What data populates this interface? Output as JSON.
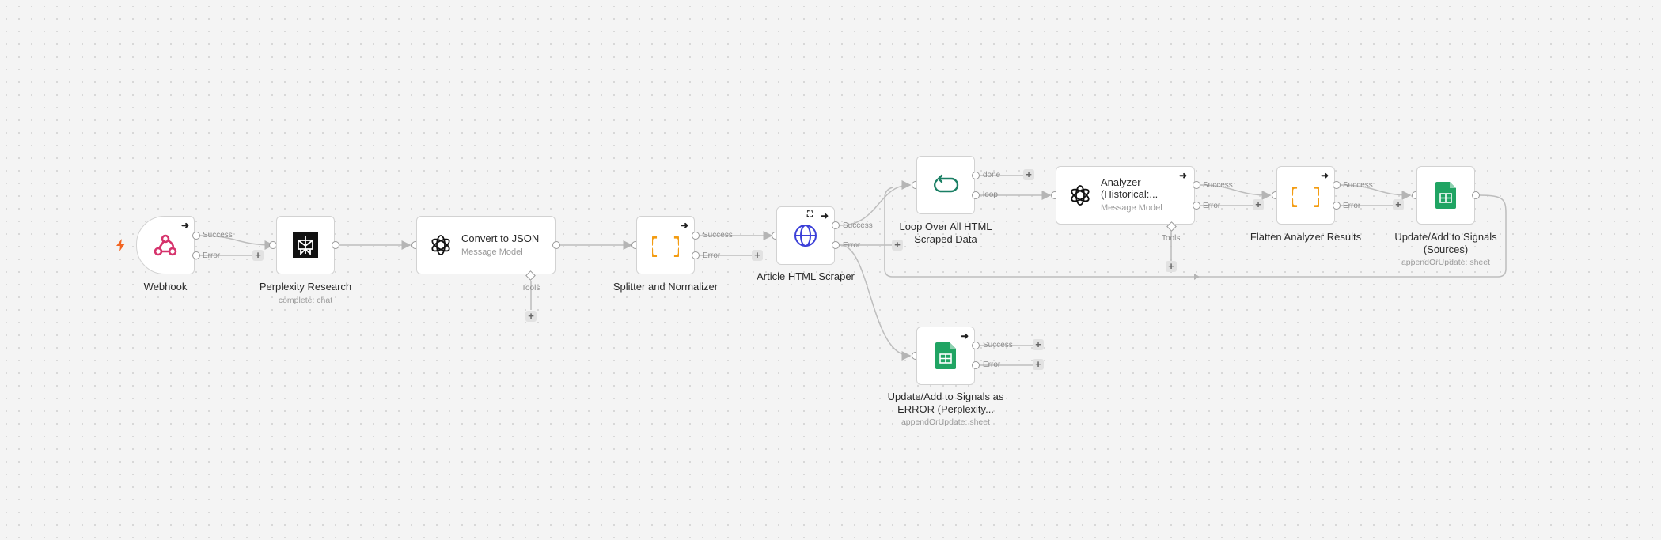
{
  "nodes": {
    "webhook": {
      "label": "Webhook"
    },
    "perplexity": {
      "label": "Perplexity Research",
      "sub": "complete: chat"
    },
    "convert": {
      "title": "Convert to JSON",
      "subtitle": "Message Model",
      "tools": "Tools"
    },
    "splitter": {
      "label": "Splitter and Normalizer"
    },
    "scraper": {
      "label": "Article HTML Scraper"
    },
    "loop": {
      "label_line1": "Loop Over All HTML",
      "label_line2": "Scraped Data"
    },
    "analyzer": {
      "title_line1": "Analyzer",
      "title_line2": "(Historical:...",
      "subtitle": "Message Model",
      "tools": "Tools"
    },
    "flatten": {
      "label": "Flatten Analyzer Results"
    },
    "update_sources": {
      "label_line1": "Update/Add to Signals",
      "label_line2": "(Sources)",
      "sub": "appendOrUpdate: sheet"
    },
    "update_error": {
      "label_line1": "Update/Add to Signals as",
      "label_line2": "ERROR (Perplexity...",
      "sub": "appendOrUpdate: sheet"
    }
  },
  "ports": {
    "success": "Success",
    "error": "Error",
    "done": "done",
    "loop": "loop"
  },
  "colors": {
    "webhook": "#d6336c",
    "braces": "#f39c12",
    "globe": "#3b3fd8",
    "loop": "#1a7f64",
    "sheets": "#20a463",
    "bolt": "#f26522"
  }
}
